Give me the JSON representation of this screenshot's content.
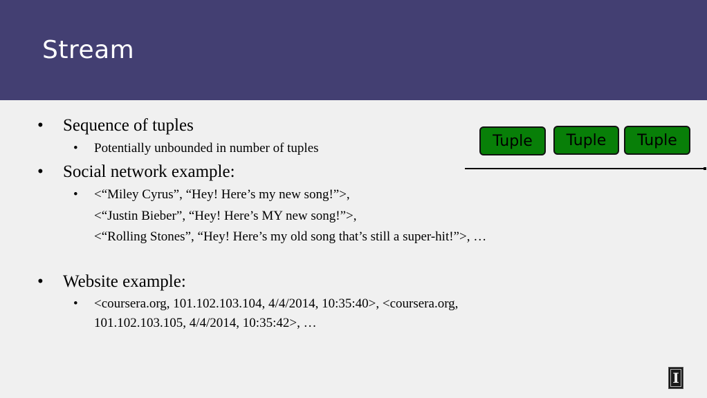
{
  "slide": {
    "title": "Stream",
    "bullets": [
      {
        "text": "Sequence of tuples",
        "sub": [
          "Potentially unbounded in number of tuples"
        ]
      },
      {
        "text": "Social network example:",
        "sub_lines": [
          "<“Miley Cyrus”, “Hey! Here’s my new song!”>,",
          "<“Justin Bieber”, “Hey! Here’s MY new song!”>,",
          "<“Rolling Stones”, “Hey! Here’s my old song that’s still a super-hit!”>, …"
        ]
      },
      {
        "text": "Website example:",
        "sub_lines": [
          "<coursera.org, 101.102.103.104, 4/4/2014, 10:35:40>, <coursera.org,",
          "101.102.103.105, 4/4/2014, 10:35:42>, …"
        ]
      }
    ],
    "bullet_glyph": "•"
  },
  "diagram": {
    "tuples": [
      "Tuple",
      "Tuple",
      "Tuple"
    ],
    "tuple_color": "#087f08",
    "arrow": "timeline-arrow"
  },
  "header_color": "#433f72",
  "logo": {
    "glyph": "I",
    "icon": "university-logo-icon"
  }
}
